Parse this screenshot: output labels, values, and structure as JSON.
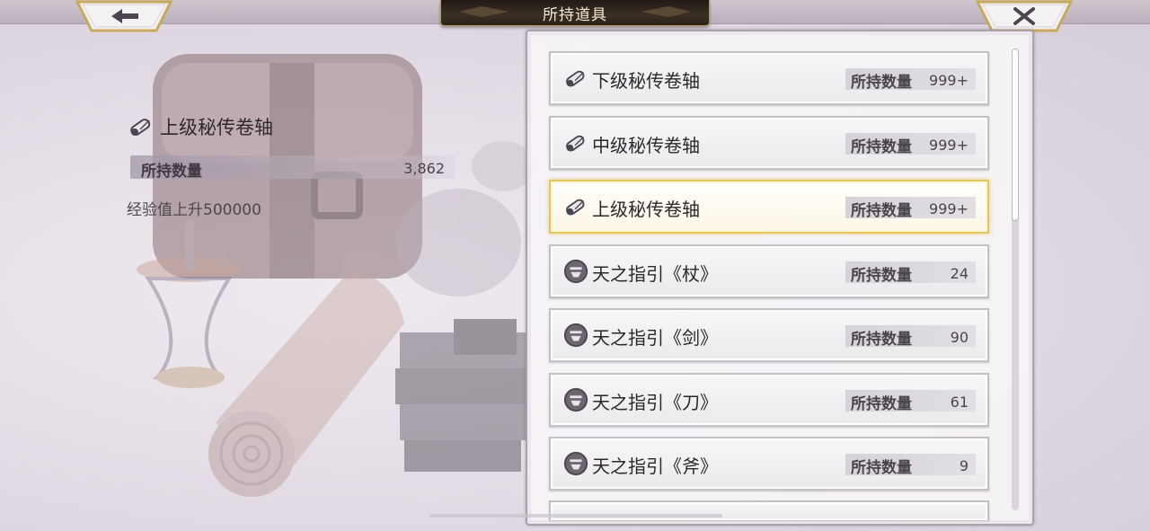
{
  "header": {
    "title": "所持道具"
  },
  "nav": {
    "back_icon": "arrow-left-icon",
    "close_icon": "close-icon"
  },
  "detail": {
    "item_name": "上级秘传卷轴",
    "icon": "scroll-icon",
    "count_label": "所持数量",
    "count_value": "3,862",
    "description": "经验值上升500000"
  },
  "items": [
    {
      "name": "下级秘传卷轴",
      "icon": "scroll-icon",
      "qty_label": "所持数量",
      "qty": "999+",
      "selected": false
    },
    {
      "name": "中级秘传卷轴",
      "icon": "scroll-icon",
      "qty_label": "所持数量",
      "qty": "999+",
      "selected": false
    },
    {
      "name": "上级秘传卷轴",
      "icon": "scroll-icon",
      "qty_label": "所持数量",
      "qty": "999+",
      "selected": true
    },
    {
      "name": "天之指引《杖》",
      "icon": "guidance-medal-icon",
      "qty_label": "所持数量",
      "qty": "24",
      "selected": false
    },
    {
      "name": "天之指引《剑》",
      "icon": "guidance-medal-icon",
      "qty_label": "所持数量",
      "qty": "90",
      "selected": false
    },
    {
      "name": "天之指引《刀》",
      "icon": "guidance-medal-icon",
      "qty_label": "所持数量",
      "qty": "61",
      "selected": false
    },
    {
      "name": "天之指引《斧》",
      "icon": "guidance-medal-icon",
      "qty_label": "所持数量",
      "qty": "9",
      "selected": false
    }
  ],
  "colors": {
    "selected_border": "#e6c55a",
    "title_plate": "#2a2219",
    "title_trim": "#b99b5a"
  }
}
